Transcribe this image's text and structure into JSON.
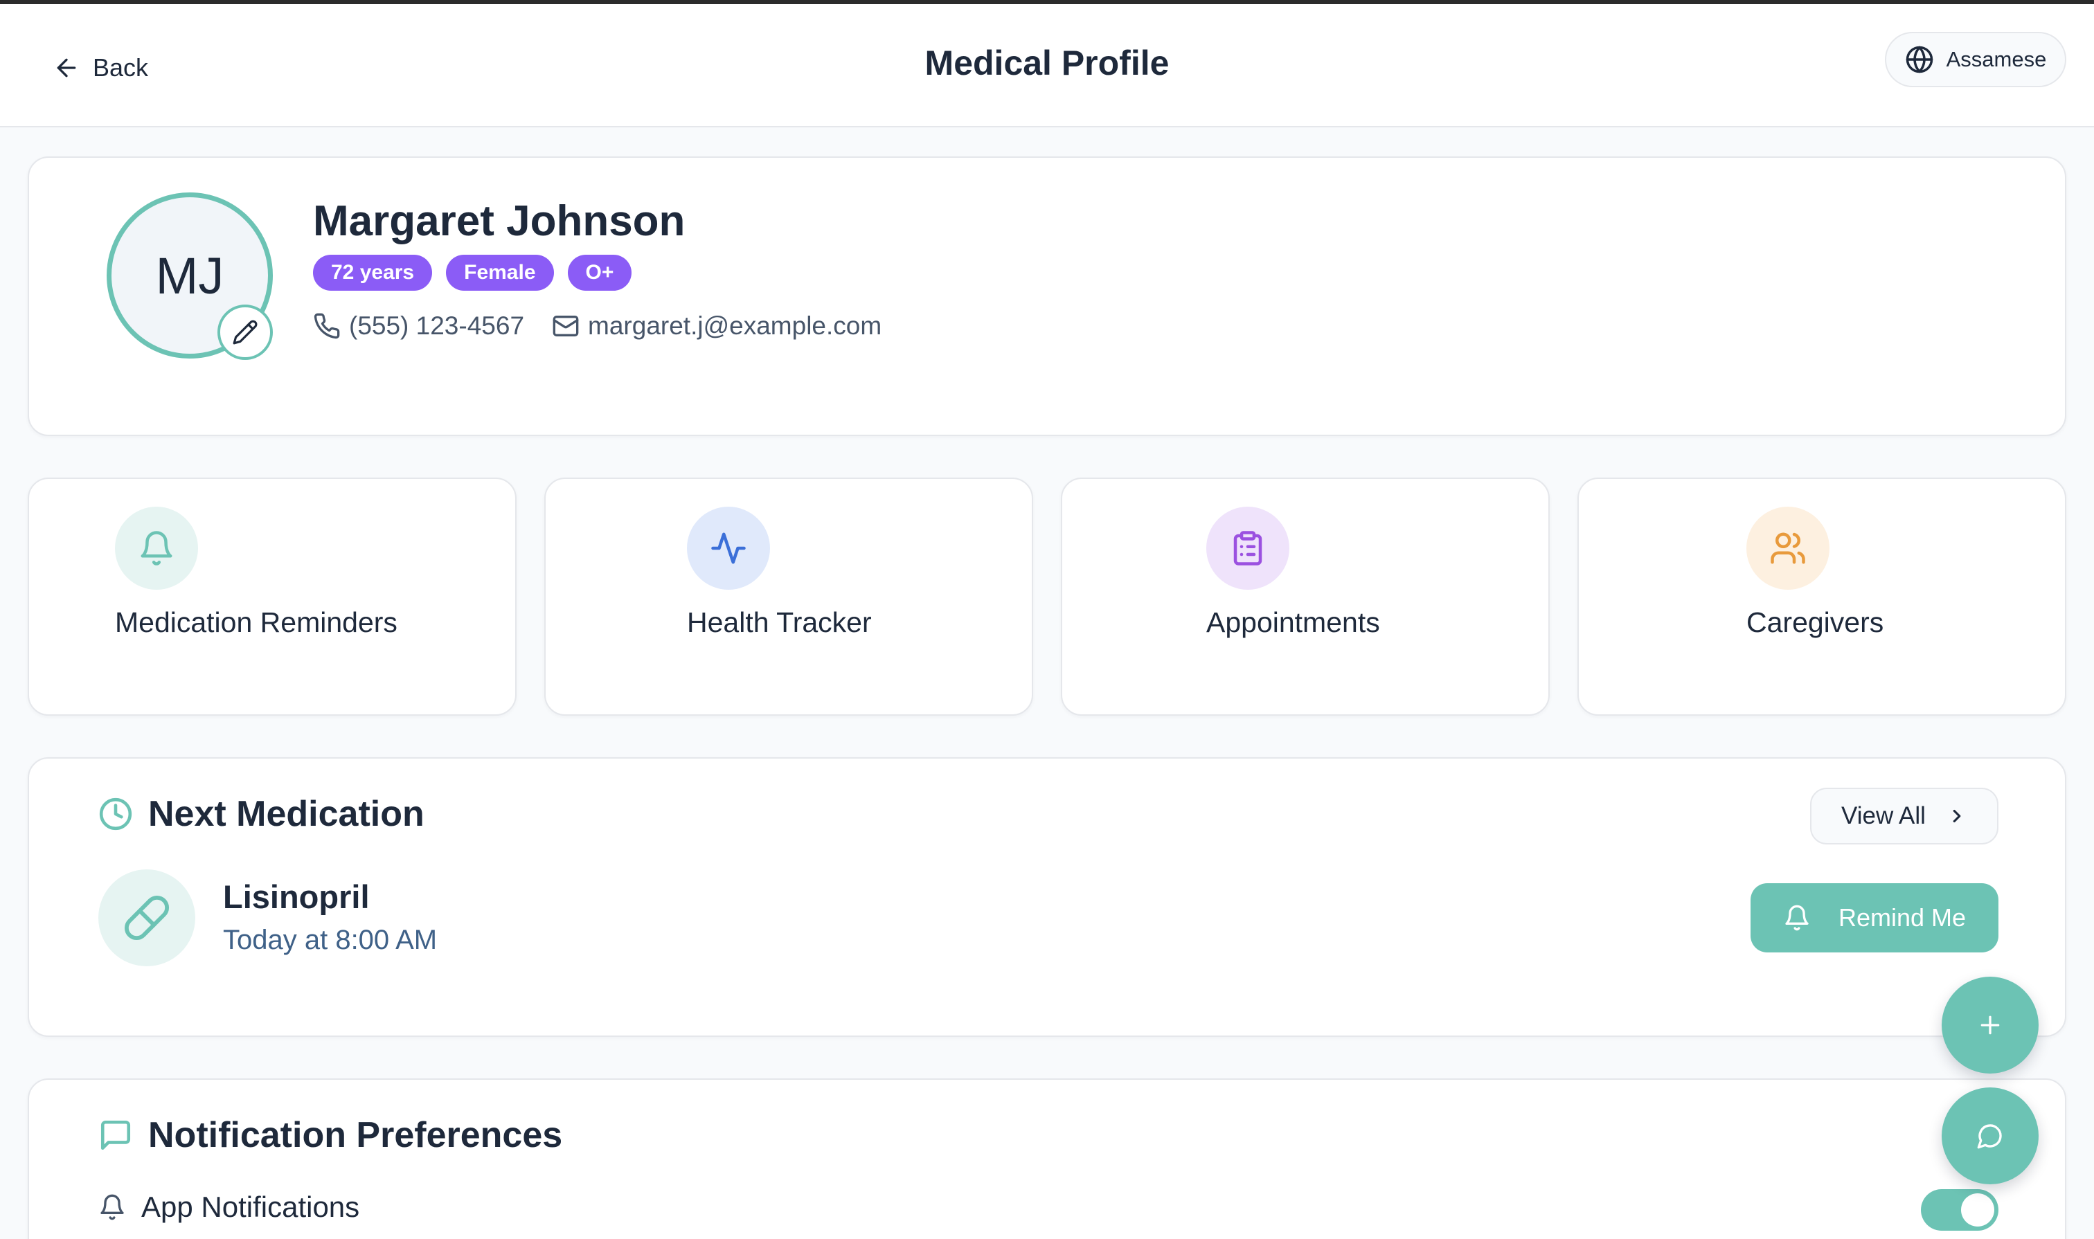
{
  "header": {
    "back_label": "Back",
    "title": "Medical Profile",
    "language": "Assamese"
  },
  "profile": {
    "initials": "MJ",
    "name": "Margaret Johnson",
    "badges": [
      "72 years",
      "Female",
      "O+"
    ],
    "phone": "(555) 123-4567",
    "email": "margaret.j@example.com",
    "accent_color": "#6cc3b4",
    "badge_color": "#8b5cf6"
  },
  "features": [
    {
      "label": "Medication Reminders",
      "icon": "bell-icon",
      "bg": "#e6f4f2",
      "color": "#6cc3b4"
    },
    {
      "label": "Health Tracker",
      "icon": "activity-icon",
      "bg": "#e0e9fb",
      "color": "#3b6fd8"
    },
    {
      "label": "Appointments",
      "icon": "clipboard-icon",
      "bg": "#efe3fb",
      "color": "#9b51e0"
    },
    {
      "label": "Caregivers",
      "icon": "users-icon",
      "bg": "#fdf0e0",
      "color": "#e89a3c"
    }
  ],
  "next_medication": {
    "title": "Next Medication",
    "view_all": "View All",
    "name": "Lisinopril",
    "time": "Today at 8:00 AM",
    "remind_label": "Remind Me"
  },
  "notifications": {
    "title": "Notification Preferences",
    "app_notifications_label": "App Notifications",
    "app_notifications_on": true
  }
}
